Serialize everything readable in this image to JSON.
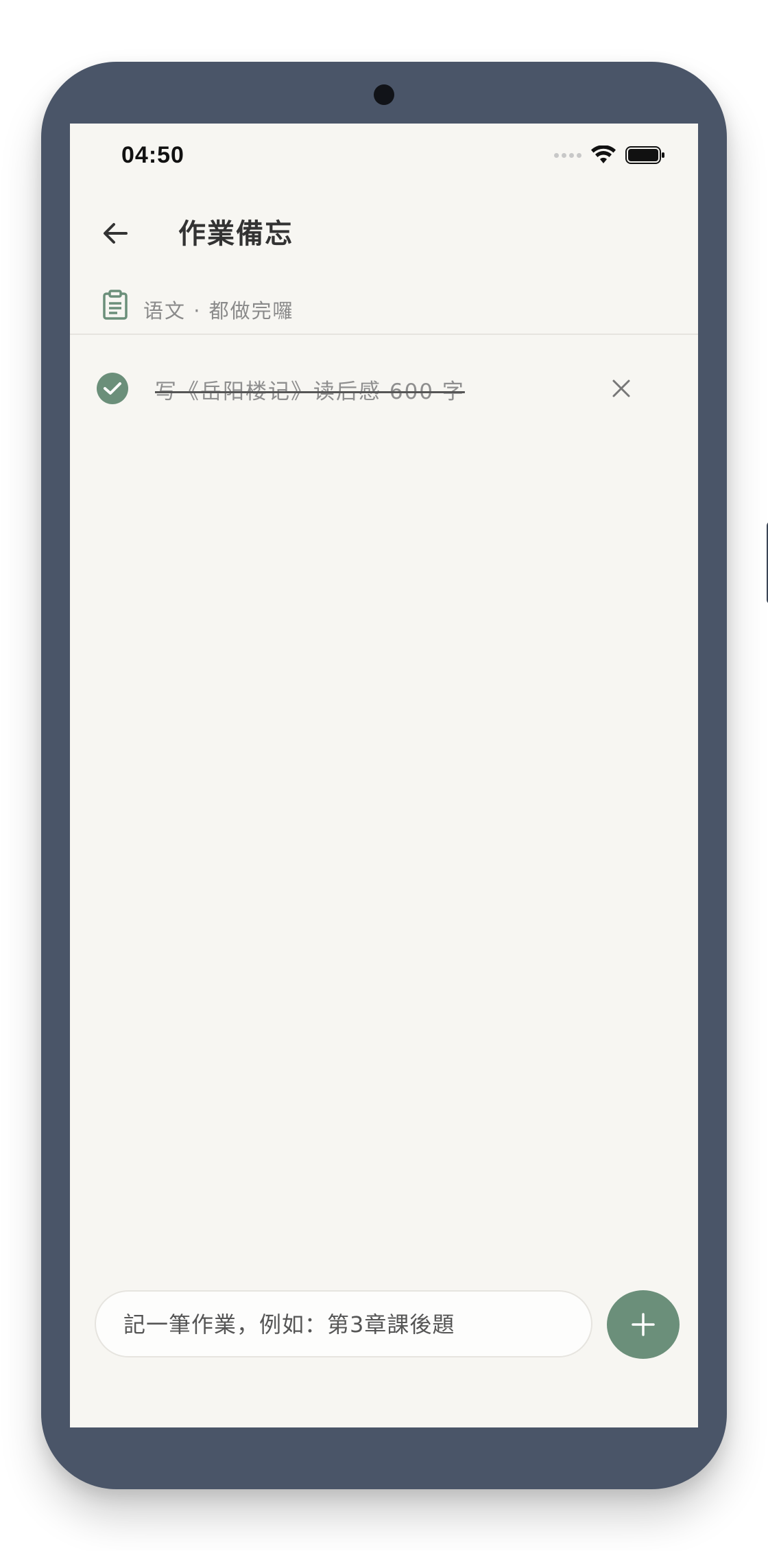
{
  "status_bar": {
    "time": "04:50"
  },
  "header": {
    "title": "作業備忘",
    "back_icon": "arrow-left-icon"
  },
  "subtitle": {
    "icon": "clipboard-icon",
    "text": "语文 · 都做完囉"
  },
  "tasks": [
    {
      "text": "写《岳阳楼记》读后感 600 字",
      "done": true
    }
  ],
  "composer": {
    "placeholder": "記一筆作業，例如：第3章課後題",
    "add_icon": "plus-icon"
  },
  "colors": {
    "accent": "#6b8f7a",
    "background": "#f7f6f2",
    "phone_frame": "#4a5568"
  }
}
